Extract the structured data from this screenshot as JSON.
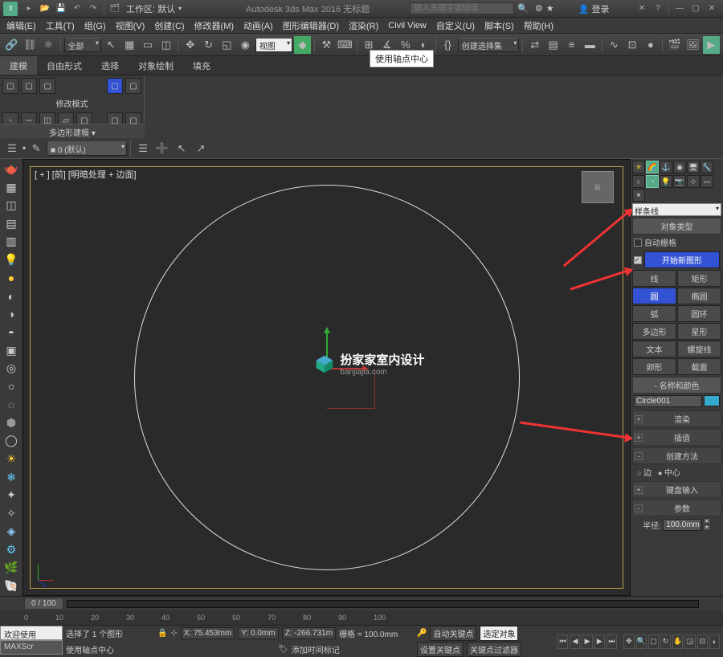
{
  "titlebar": {
    "workspace_prefix": "工作区: 默认",
    "app_title": "Autodesk 3ds Max 2016    无标题",
    "search_placeholder": "键入关键字或短语",
    "login": "登录"
  },
  "menus": [
    "编辑(E)",
    "工具(T)",
    "组(G)",
    "视图(V)",
    "创建(C)",
    "修改器(M)",
    "动画(A)",
    "图形编辑器(D)",
    "渲染(R)",
    "Civil View",
    "自定义(U)",
    "脚本(S)",
    "帮助(H)"
  ],
  "toolbar": {
    "all": "全部",
    "view_combo": "视图",
    "select_set": "创建选择集"
  },
  "tooltip": "使用轴点中心",
  "ribbon": {
    "tabs": [
      "建模",
      "自由形式",
      "选择",
      "对象绘制",
      "填充"
    ],
    "edit_mode": "修改模式",
    "poly": "多边形建模 ▾"
  },
  "layerbar": {
    "layer": "0 (默认)"
  },
  "viewport": {
    "label": "[ + ] [前] [明暗处理 + 边面]",
    "watermark_title": "扮家家室内设计",
    "watermark_sub": "banjiajia.com",
    "viewcube": "前"
  },
  "right_panel": {
    "combo": "样条线",
    "object_type": "对象类型",
    "autogrid": "自动栅格",
    "start_new": "开始新图形",
    "shapes": [
      [
        "线",
        "矩形"
      ],
      [
        "圆",
        "椭圆"
      ],
      [
        "弧",
        "圆环"
      ],
      [
        "多边形",
        "星形"
      ],
      [
        "文本",
        "螺旋线"
      ],
      [
        "卵形",
        "截面"
      ]
    ],
    "name_color": "名称和颜色",
    "obj_name": "Circle001",
    "render": "渲染",
    "interp": "插值",
    "create_method": "创建方法",
    "edge": "边",
    "center": "中心",
    "keyboard": "键盘输入",
    "params": "参数",
    "radius_label": "半径:",
    "radius_value": "100.0mm"
  },
  "timeslider": {
    "handle": "0 / 100",
    "ticks": [
      "0",
      "10",
      "20",
      "30",
      "40",
      "50",
      "60",
      "70",
      "80",
      "90",
      "100"
    ]
  },
  "statusbar": {
    "welcome": "欢迎使用",
    "maxscr": "MAXScr",
    "sel": "选择了 1 个图形",
    "pivot": "使用轴点中心",
    "x": "X: 75.453mm",
    "y": "Y: 0.0mm",
    "z": "Z: -266.731m",
    "grid": "栅格 = 100.0mm",
    "addtime": "添加时间标记",
    "autokey": "自动关键点",
    "selobj": "选定对象",
    "setkey": "设置关键点",
    "keyfilter": "关键点过滤器"
  }
}
